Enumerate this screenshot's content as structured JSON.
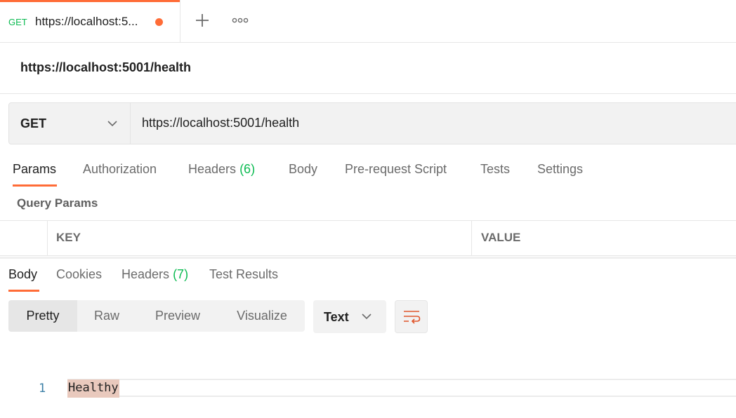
{
  "tab": {
    "method": "GET",
    "title": "https://localhost:5...",
    "add_icon": "plus-icon",
    "more_icon": "ellipsis-icon"
  },
  "request": {
    "name": "https://localhost:5001/health",
    "method": "GET",
    "url": "https://localhost:5001/health"
  },
  "request_tabs": [
    {
      "label": "Params"
    },
    {
      "label": "Authorization"
    },
    {
      "label": "Headers",
      "count": "(6)"
    },
    {
      "label": "Body"
    },
    {
      "label": "Pre-request Script"
    },
    {
      "label": "Tests"
    },
    {
      "label": "Settings"
    }
  ],
  "params": {
    "title": "Query Params",
    "columns": [
      "KEY",
      "VALUE"
    ]
  },
  "response_tabs": [
    {
      "label": "Body"
    },
    {
      "label": "Cookies"
    },
    {
      "label": "Headers",
      "count": "(7)"
    },
    {
      "label": "Test Results"
    }
  ],
  "view_modes": [
    "Pretty",
    "Raw",
    "Preview",
    "Visualize"
  ],
  "format": "Text",
  "wrap_icon": "wrap-lines-icon",
  "response_body": {
    "line_number": "1",
    "text": "Healthy"
  },
  "colors": {
    "accent": "#ff6c37",
    "method_get": "#0cbb52",
    "count": "#0cbb52"
  }
}
